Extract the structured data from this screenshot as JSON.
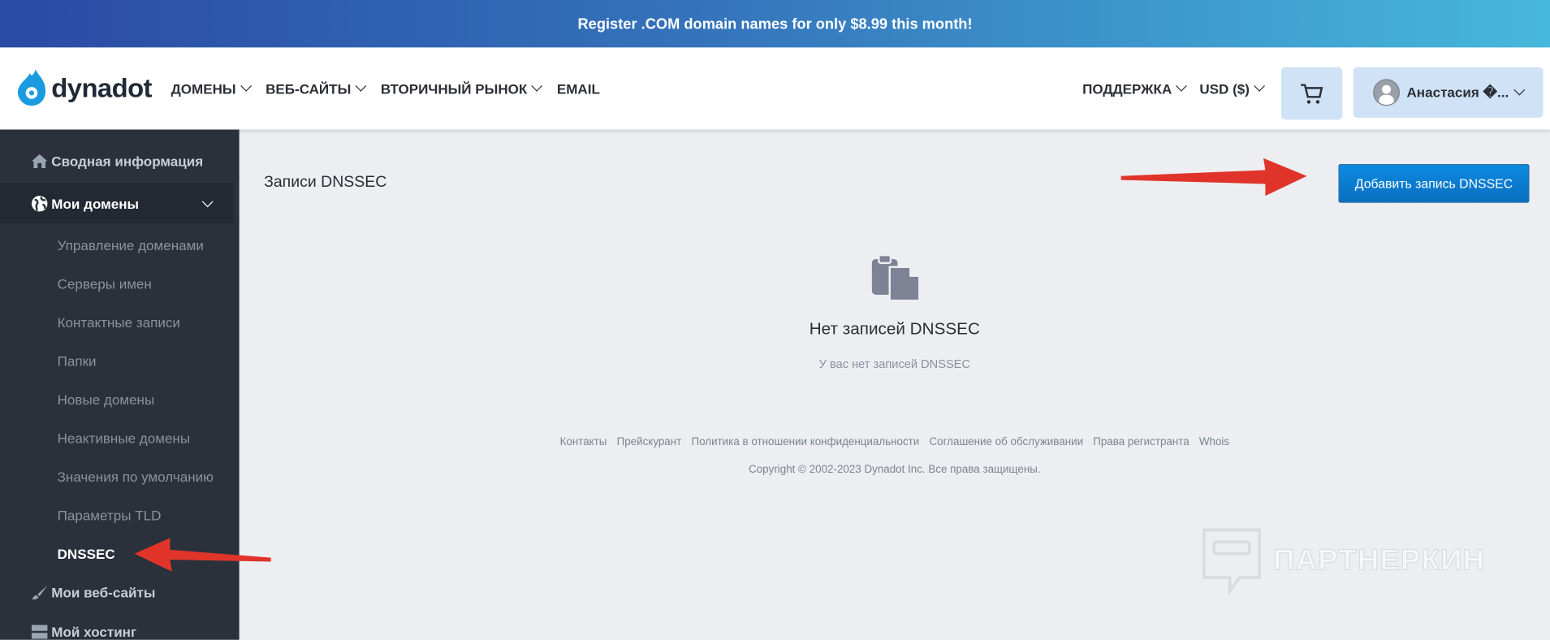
{
  "banner": {
    "text": "Register .COM domain names for only $8.99 this month!"
  },
  "header": {
    "logo": "dynadot",
    "nav": [
      {
        "label": "ДОМЕНЫ"
      },
      {
        "label": "ВЕБ-САЙТЫ"
      },
      {
        "label": "ВТОРИЧНЫЙ РЫНОК"
      },
      {
        "label": "EMAIL"
      }
    ],
    "support": "ПОДДЕРЖКА",
    "currency": "USD ($)",
    "user": "Анастасия �..."
  },
  "sidebar": {
    "summary": "Сводная информация",
    "my_domains": "Мои домены",
    "sub": [
      "Управление доменами",
      "Серверы имен",
      "Контактные записи",
      "Папки",
      "Новые домены",
      "Неактивные домены",
      "Значения по умолчанию",
      "Параметры TLD",
      "DNSSEC"
    ],
    "my_websites": "Мои веб-сайты",
    "my_hosting": "Мой хостинг"
  },
  "main": {
    "title": "Записи DNSSEC",
    "add_button": "Добавить запись DNSSEC",
    "empty_title": "Нет записей DNSSEC",
    "empty_text": "У вас нет записей DNSSEC"
  },
  "footer": {
    "links": [
      "Контакты",
      "Прейскурант",
      "Политика в отношении конфиденциальности",
      "Соглашение об обслуживании",
      "Права регистранта",
      "Whois"
    ],
    "copyright": "Copyright © 2002-2023 Dynadot Inc. Все права защищены."
  },
  "watermark": "ПАРТНЕРКИН",
  "colors": {
    "accent": "#0a7fd4",
    "sidebar": "#2a313b",
    "arrow": "#e0342a"
  }
}
